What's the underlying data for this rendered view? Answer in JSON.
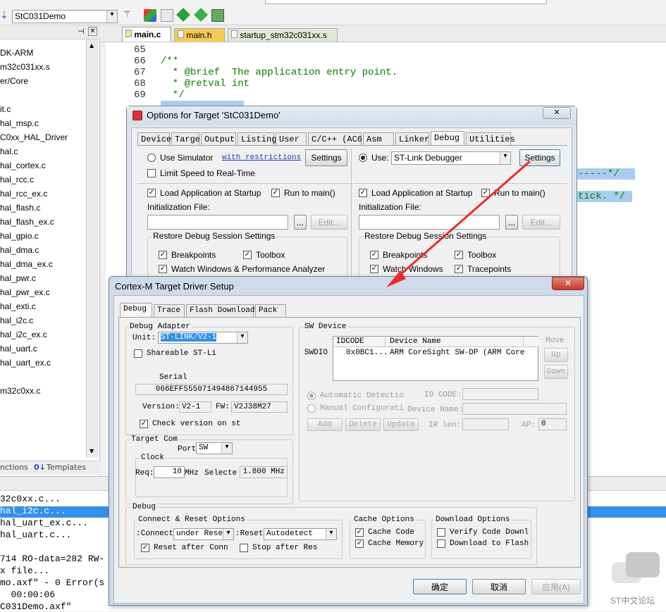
{
  "toolbar": {
    "target": "StC031Demo"
  },
  "project_tree": [
    "DK-ARM",
    "m32c031xx.s",
    "er/Core",
    "",
    "it.c",
    "hal_msp.c",
    "C0xx_HAL_Driver",
    "hal.c",
    "hal_cortex.c",
    "hal_rcc.c",
    "hal_rcc_ex.c",
    "hal_flash.c",
    "hal_flash_ex.c",
    "hal_gpio.c",
    "hal_dma.c",
    "hal_dma_ex.c",
    "hal_pwr.c",
    "hal_pwr_ex.c",
    "hal_exti.c",
    "hal_i2c.c",
    "hal_i2c_ex.c",
    "hal_uart.c",
    "hal_uart_ex.c",
    "",
    "m32c0xx.c"
  ],
  "bottom_tabs": {
    "functions": "nctions",
    "templates": "Templates"
  },
  "editor_tabs": [
    "main.c",
    "main.h",
    "startup_stm32c031xx.s"
  ],
  "code_lines": [
    {
      "num": "65",
      "text": ""
    },
    {
      "num": "66",
      "text": "/**"
    },
    {
      "num": "67",
      "text": "  * @brief  The application entry point."
    },
    {
      "num": "68",
      "text": "  * @retval int"
    },
    {
      "num": "69",
      "text": "  */"
    }
  ],
  "code_right_1": "-----*/",
  "code_right_2": "tick. */",
  "build_output": [
    "32c0xx.c...",
    "hal_i2c.c...",
    "hal_uart_ex.c...",
    "hal_uart.c...",
    "",
    "714 RO-data=282 RW-",
    "x file...",
    "mo.axf\" - 0 Error(s",
    "  00:00:06",
    "C031Demo.axf\""
  ],
  "options_dialog": {
    "title": "Options for Target 'StC031Demo'",
    "tabs": [
      "Device",
      "Target",
      "Output",
      "Listing",
      "User",
      "C/C++ (AC6)",
      "Asm",
      "Linker",
      "Debug",
      "Utilities"
    ],
    "use_simulator": "Use Simulator",
    "with_restrictions": "with restrictions",
    "settings": "Settings",
    "limit_speed": "Limit Speed to Real-Time",
    "use": "Use:",
    "debugger": "ST-Link Debugger",
    "load_app": "Load Application at Startup",
    "run_main": "Run to main()",
    "init_file": "Initialization File:",
    "browse": "...",
    "edit": "Edit...",
    "restore": "Restore Debug Session Settings",
    "breakpoints": "Breakpoints",
    "toolbox": "Toolbox",
    "watch_windows_perf": "Watch Windows & Performance Analyzer",
    "watch_windows": "Watch Windows",
    "tracepoints": "Tracepoints"
  },
  "cortex_dialog": {
    "title": "Cortex-M Target Driver Setup",
    "tabs": [
      "Debug",
      "Trace",
      "Flash Download",
      "Pack"
    ],
    "debug_adapter": {
      "title": "Debug Adapter",
      "unit_label": "Unit:",
      "unit": "ST-LINK/V2-1",
      "shareable": "Shareable ST-Li",
      "serial_label": "Serial",
      "serial": "066EFF555071494867144955",
      "version_label": "Version:",
      "version": "V2-1",
      "fw_label": "FW:",
      "fw": "V2J38M27",
      "check_version": "Check version on st"
    },
    "target_com": {
      "title": "Target Com",
      "port_label": "Port",
      "port": "SW",
      "clock_title": "Clock",
      "req_label": "Req:",
      "req": "10",
      "mhz": "MHz",
      "selected_label": "Selecte",
      "selected": "1.800 MHz"
    },
    "sw_device": {
      "title": "SW Device",
      "swdio": "SWDIO",
      "col_idcode": "IDCODE",
      "col_name": "Device Name",
      "idcode": "0x0BC1...",
      "name": "ARM CoreSight SW-DP (ARM Core",
      "move": "Move",
      "up": "Up",
      "down": "Down",
      "auto_detect": "Automatic Detectio",
      "manual_config": "Manual Configurati",
      "id_code_label": "ID CODE:",
      "device_name_label": "Device Name:",
      "ir_len_label": "IR len:",
      "ap_label": "AP:",
      "ap": "0",
      "add": "Add",
      "delete": "Delete",
      "update": "Update"
    },
    "debug_group": {
      "title": "Debug",
      "connect_reset": "Connect & Reset Options",
      "connect_label": "Connect:",
      "connect": "under Reset",
      "reset_label": "Reset:",
      "reset": "Autodetect",
      "reset_after_conn": "Reset after Conn",
      "stop_after_res": "Stop after Res",
      "cache_options": "Cache Options",
      "cache_code": "Cache Code",
      "cache_memory": "Cache Memory",
      "download_options": "Download Options",
      "verify_code": "Verify Code Downlo",
      "download_to_flash": "Download to Flash"
    },
    "ok": "确定",
    "cancel": "取消",
    "apply": "应用(A)"
  },
  "watermark": "ST中文论坛"
}
